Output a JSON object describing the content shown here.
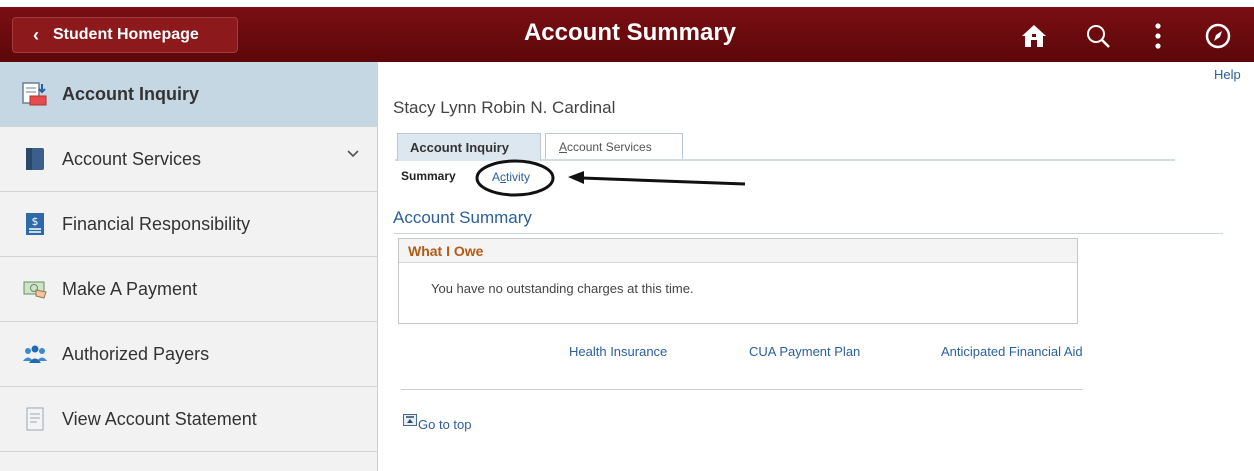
{
  "header": {
    "back_label": "Student Homepage",
    "title": "Account Summary",
    "icons": [
      "home-icon",
      "search-icon",
      "more-vertical-icon",
      "compass-icon"
    ]
  },
  "sidebar": {
    "items": [
      {
        "label": "Account Inquiry",
        "icon": "account-inquiry-icon",
        "active": true
      },
      {
        "label": "Account Services",
        "icon": "account-services-icon",
        "expandable": true
      },
      {
        "label": "Financial Responsibility",
        "icon": "financial-responsibility-icon"
      },
      {
        "label": "Make A Payment",
        "icon": "payment-icon"
      },
      {
        "label": "Authorized Payers",
        "icon": "authorized-payers-icon"
      },
      {
        "label": "View Account Statement",
        "icon": "statement-icon"
      }
    ]
  },
  "content": {
    "help": "Help",
    "student_name": "Stacy Lynn Robin N. Cardinal",
    "tabs": [
      {
        "label": "Account Inquiry",
        "active": true
      },
      {
        "label_first": "A",
        "label_rest": "ccount Services"
      }
    ],
    "subtabs": {
      "summary": "Summary",
      "activity_first": "A",
      "activity_underlined": "c",
      "activity_rest": "tivity"
    },
    "section_title": "Account Summary",
    "what_i_owe": {
      "title": "What I Owe",
      "message": "You have no outstanding charges at this time."
    },
    "links": [
      "Health Insurance",
      "CUA Payment Plan",
      "Anticipated Financial Aid"
    ],
    "go_to_top": "Go to top"
  },
  "colors": {
    "header": "#6b0b0f",
    "active_item": "#c5d7e2",
    "link": "#2b5f9e",
    "owe_title": "#b35a15"
  }
}
